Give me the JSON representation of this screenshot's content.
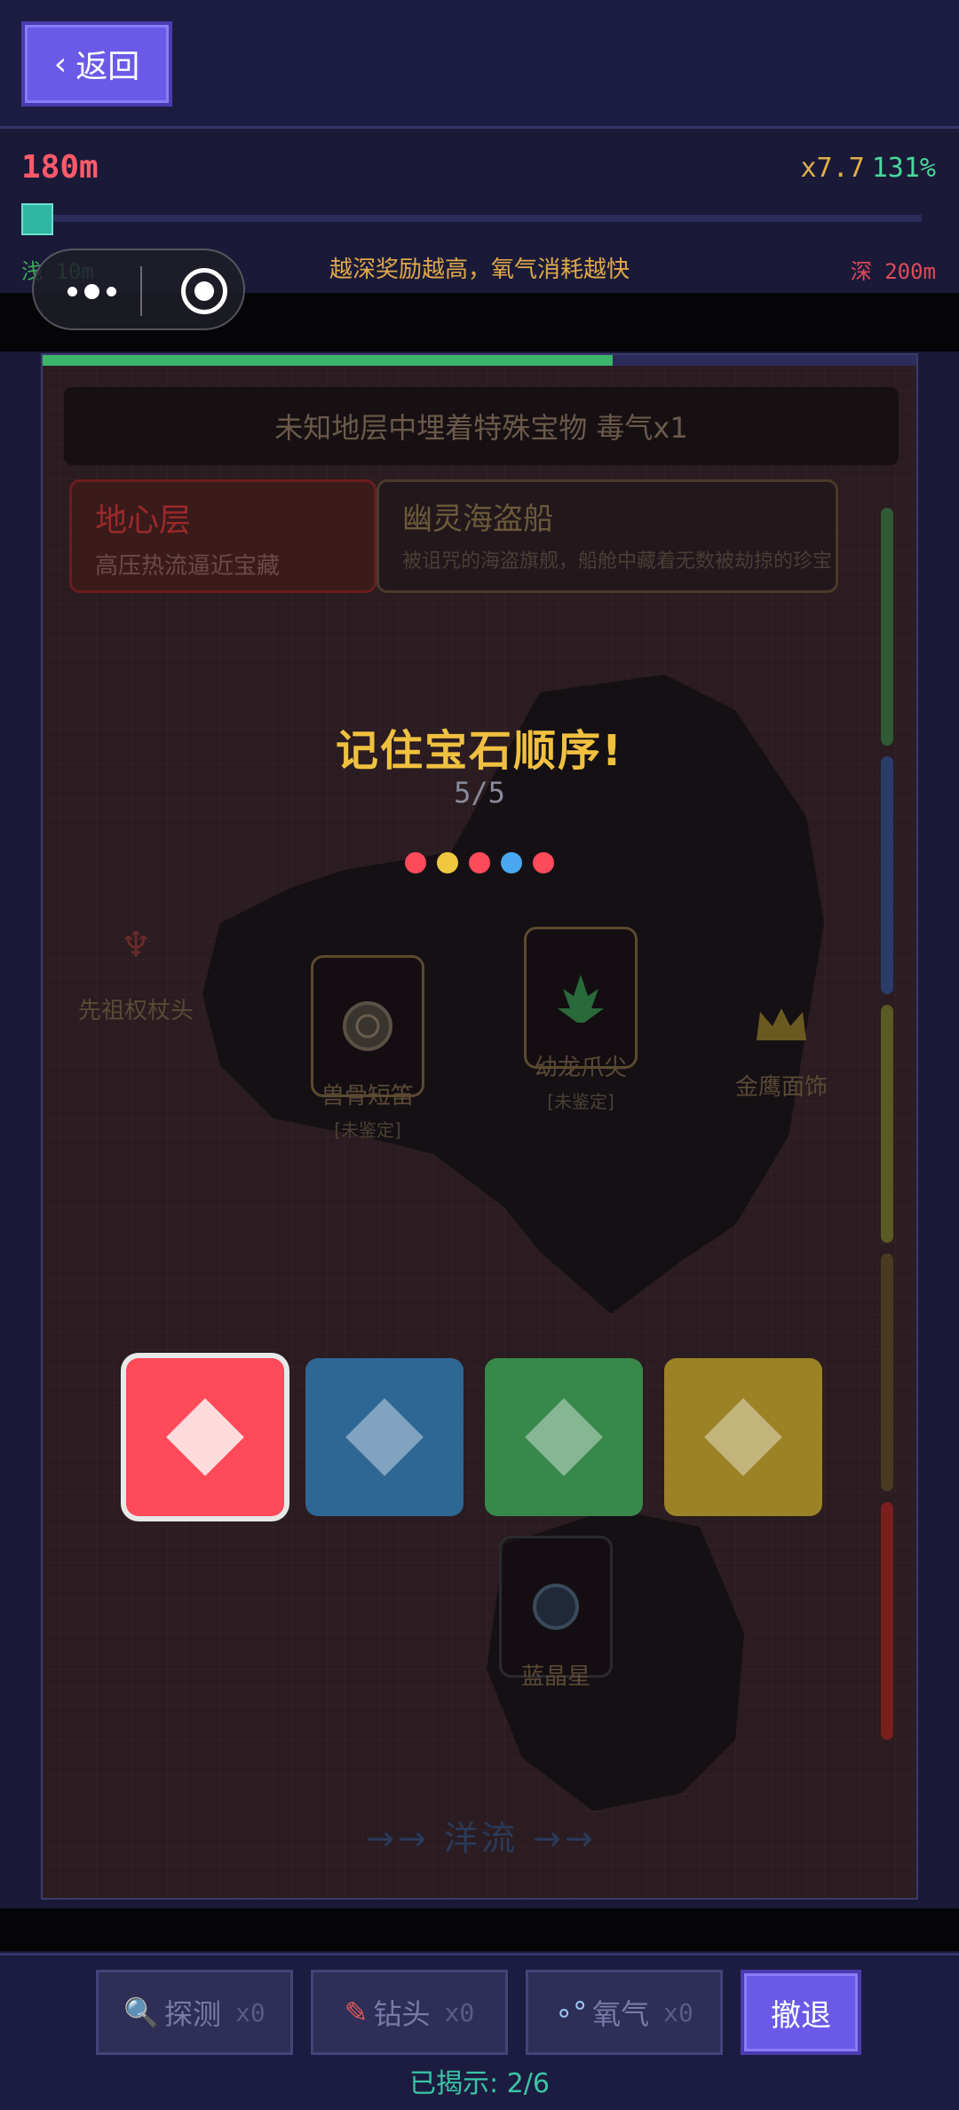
{
  "header": {
    "back_label": "返回"
  },
  "status": {
    "depth": "180m",
    "multiplier": "x7.7",
    "oxygen_percent": "131%",
    "shallow_label": "浅 10m",
    "tip": "越深奖励越高，氧气消耗越快",
    "deep_label": "深 200m",
    "depth_progress": 0.0
  },
  "oxygen_bar_fraction": 0.65,
  "event_banner": "未知地层中埋着特殊宝物   毒气x1",
  "layers": [
    {
      "title": "地心层",
      "desc": "高压热流逼近宝藏"
    },
    {
      "title": "幽灵海盗船",
      "desc": "被诅咒的海盗旗舰，船舱中藏着无数被劫掠的珍宝"
    }
  ],
  "treasures": [
    {
      "name": "先祖权杖头",
      "tag": ""
    },
    {
      "name": "兽骨短笛",
      "tag": "[未鉴定]"
    },
    {
      "name": "幼龙爪尖",
      "tag": "[未鉴定]"
    },
    {
      "name": "金鹰面饰",
      "tag": ""
    },
    {
      "name": "蓝晶星",
      "tag": ""
    }
  ],
  "current_label": "→→ 洋流 →→",
  "memory": {
    "title": "记住宝石顺序!",
    "counter": "5/5",
    "sequence_colors": [
      "#ff4a5a",
      "#f0c840",
      "#ff4a5a",
      "#4aa8f0",
      "#ff4a5a"
    ]
  },
  "gems": [
    {
      "color": "#ff4a5a",
      "name": "red",
      "selected": true
    },
    {
      "color": "#2e6694",
      "name": "blue",
      "selected": false
    },
    {
      "color": "#37884a",
      "name": "green",
      "selected": false
    },
    {
      "color": "#9c8226",
      "name": "yellow",
      "selected": false
    }
  ],
  "toolbar": {
    "probe_label": "探测",
    "probe_count": "x0",
    "drill_label": "钻头",
    "drill_count": "x0",
    "oxygen_label": "氧气",
    "oxygen_count": "x0",
    "retreat_label": "撤退",
    "revealed": "已揭示: 2/6"
  },
  "side_meter_colors": [
    "#2f5a34",
    "#2a3c6a",
    "#5a5a24",
    "#4a3a22",
    "#7a1e1e"
  ]
}
